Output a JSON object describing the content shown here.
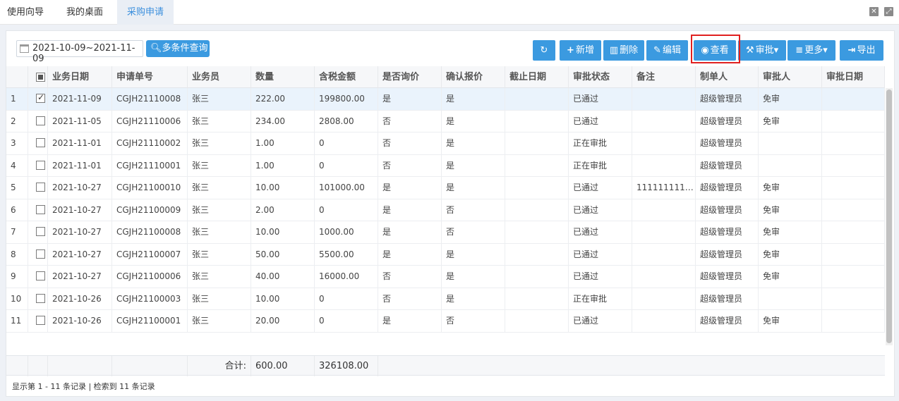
{
  "tabs": [
    {
      "label": "使用向导"
    },
    {
      "label": "我的桌面"
    },
    {
      "label": "采购申请"
    }
  ],
  "toolbar": {
    "date_range": "2021-10-09~2021-11-09",
    "search_label": "多条件查询",
    "refresh_icon": "↻",
    "add_label": "新增",
    "delete_label": "删除",
    "edit_label": "编辑",
    "view_label": "查看",
    "approve_label": "审批▾",
    "more_label": "更多▾",
    "export_label": "导出"
  },
  "columns": [
    "业务日期",
    "申请单号",
    "业务员",
    "数量",
    "含税金额",
    "是否询价",
    "确认报价",
    "截止日期",
    "审批状态",
    "备注",
    "制单人",
    "审批人",
    "审批日期"
  ],
  "rows": [
    {
      "n": "1",
      "checked": true,
      "date": "2021-11-09",
      "no": "CGJH21110008",
      "staff": "张三",
      "qty": "222.00",
      "amt": "199800.00",
      "inq": "是",
      "conf": "是",
      "due": "",
      "status": "已通过",
      "remark": "",
      "maker": "超级管理员",
      "approver": "免审",
      "adate": ""
    },
    {
      "n": "2",
      "checked": false,
      "date": "2021-11-05",
      "no": "CGJH21110006",
      "staff": "张三",
      "qty": "234.00",
      "amt": "2808.00",
      "inq": "否",
      "conf": "是",
      "due": "",
      "status": "已通过",
      "remark": "",
      "maker": "超级管理员",
      "approver": "免审",
      "adate": ""
    },
    {
      "n": "3",
      "checked": false,
      "date": "2021-11-01",
      "no": "CGJH21110002",
      "staff": "张三",
      "qty": "1.00",
      "amt": "0",
      "inq": "否",
      "conf": "是",
      "due": "",
      "status": "正在审批",
      "remark": "",
      "maker": "超级管理员",
      "approver": "",
      "adate": ""
    },
    {
      "n": "4",
      "checked": false,
      "date": "2021-11-01",
      "no": "CGJH21110001",
      "staff": "张三",
      "qty": "1.00",
      "amt": "0",
      "inq": "否",
      "conf": "是",
      "due": "",
      "status": "正在审批",
      "remark": "",
      "maker": "超级管理员",
      "approver": "",
      "adate": ""
    },
    {
      "n": "5",
      "checked": false,
      "date": "2021-10-27",
      "no": "CGJH21100010",
      "staff": "张三",
      "qty": "10.00",
      "amt": "101000.00",
      "inq": "是",
      "conf": "是",
      "due": "",
      "status": "已通过",
      "remark": "1111111111...",
      "maker": "超级管理员",
      "approver": "免审",
      "adate": ""
    },
    {
      "n": "6",
      "checked": false,
      "date": "2021-10-27",
      "no": "CGJH21100009",
      "staff": "张三",
      "qty": "2.00",
      "amt": "0",
      "inq": "是",
      "conf": "否",
      "due": "",
      "status": "已通过",
      "remark": "",
      "maker": "超级管理员",
      "approver": "免审",
      "adate": ""
    },
    {
      "n": "7",
      "checked": false,
      "date": "2021-10-27",
      "no": "CGJH21100008",
      "staff": "张三",
      "qty": "10.00",
      "amt": "1000.00",
      "inq": "是",
      "conf": "否",
      "due": "",
      "status": "已通过",
      "remark": "",
      "maker": "超级管理员",
      "approver": "免审",
      "adate": ""
    },
    {
      "n": "8",
      "checked": false,
      "date": "2021-10-27",
      "no": "CGJH21100007",
      "staff": "张三",
      "qty": "50.00",
      "amt": "5500.00",
      "inq": "是",
      "conf": "是",
      "due": "",
      "status": "已通过",
      "remark": "",
      "maker": "超级管理员",
      "approver": "免审",
      "adate": ""
    },
    {
      "n": "9",
      "checked": false,
      "date": "2021-10-27",
      "no": "CGJH21100006",
      "staff": "张三",
      "qty": "40.00",
      "amt": "16000.00",
      "inq": "否",
      "conf": "是",
      "due": "",
      "status": "已通过",
      "remark": "",
      "maker": "超级管理员",
      "approver": "免审",
      "adate": ""
    },
    {
      "n": "10",
      "checked": false,
      "date": "2021-10-26",
      "no": "CGJH21100003",
      "staff": "张三",
      "qty": "10.00",
      "amt": "0",
      "inq": "否",
      "conf": "是",
      "due": "",
      "status": "正在审批",
      "remark": "",
      "maker": "超级管理员",
      "approver": "",
      "adate": ""
    },
    {
      "n": "11",
      "checked": false,
      "date": "2021-10-26",
      "no": "CGJH21100001",
      "staff": "张三",
      "qty": "20.00",
      "amt": "0",
      "inq": "是",
      "conf": "否",
      "due": "",
      "status": "已通过",
      "remark": "",
      "maker": "超级管理员",
      "approver": "免审",
      "adate": ""
    }
  ],
  "totals": {
    "label": "合计:",
    "qty": "600.00",
    "amt": "326108.00"
  },
  "status_text": "显示第 1 - 11 条记录 | 检索到 11 条记录",
  "colors": {
    "accent": "#3b9ae0",
    "highlight": "#e02020",
    "selected_row": "#eaf3fc"
  }
}
